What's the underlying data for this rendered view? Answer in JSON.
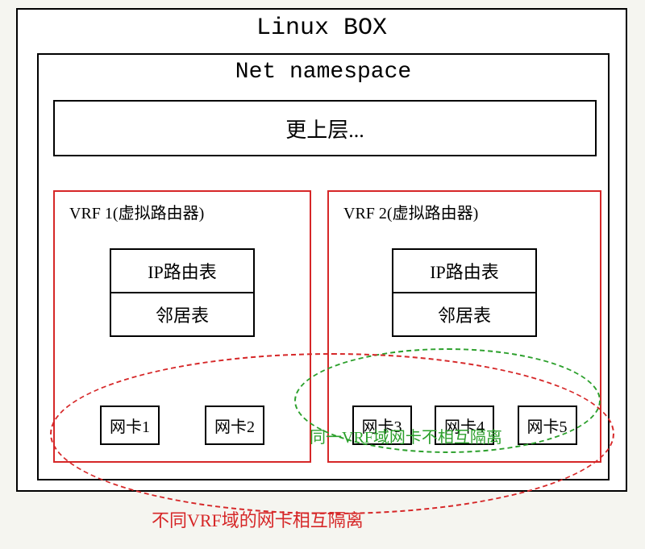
{
  "linux_box_title": "Linux BOX",
  "net_ns_title": "Net namespace",
  "upper_layer": "更上层...",
  "vrf1": {
    "title": "VRF 1(虚拟路由器)",
    "ip_table": "IP路由表",
    "neighbor_table": "邻居表",
    "nics": [
      "网卡1",
      "网卡2"
    ]
  },
  "vrf2": {
    "title": "VRF 2(虚拟路由器)",
    "ip_table": "IP路由表",
    "neighbor_table": "邻居表",
    "nics": [
      "网卡3",
      "网卡4",
      "网卡5"
    ]
  },
  "annotation_same_vrf": "同一VRF域网卡不相互隔离",
  "annotation_diff_vrf": "不同VRF域的网卡相互隔离"
}
